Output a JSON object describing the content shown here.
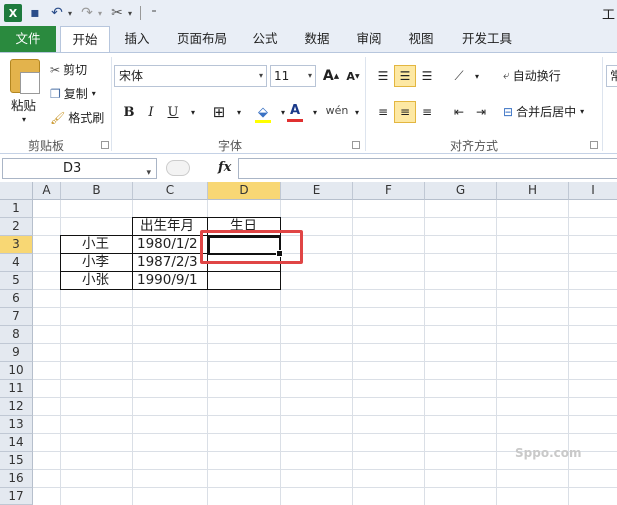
{
  "app": {
    "title_fragment": "工",
    "icons": [
      "excel-icon",
      "save-icon",
      "undo-icon",
      "redo-icon",
      "tools-icon"
    ]
  },
  "tabs": [
    {
      "label": "文件"
    },
    {
      "label": "开始"
    },
    {
      "label": "插入"
    },
    {
      "label": "页面布局"
    },
    {
      "label": "公式"
    },
    {
      "label": "数据"
    },
    {
      "label": "审阅"
    },
    {
      "label": "视图"
    },
    {
      "label": "开发工具"
    }
  ],
  "ribbon": {
    "clipboard": {
      "paste": "粘贴",
      "cut": "剪切",
      "copy": "复制",
      "format_painter": "格式刷",
      "group": "剪贴板"
    },
    "font": {
      "name": "宋体",
      "size": "11",
      "bold": "B",
      "italic": "I",
      "underline": "U",
      "group": "字体"
    },
    "alignment": {
      "wrap": "自动换行",
      "merge": "合并后居中",
      "group": "对齐方式"
    },
    "number": {
      "fragment": "常"
    }
  },
  "formula_bar": {
    "name_box": "D3",
    "fx": "fx",
    "value": ""
  },
  "sheet": {
    "columns": [
      "A",
      "B",
      "C",
      "D",
      "E",
      "F",
      "G",
      "H",
      "I"
    ],
    "rows": [
      "1",
      "2",
      "3",
      "4",
      "5",
      "6",
      "7",
      "8",
      "9",
      "10",
      "11",
      "12",
      "13",
      "14",
      "15",
      "16",
      "17"
    ],
    "selected_column": "D",
    "selected_row": "3",
    "cells": {
      "C2": "出生年月",
      "D2": "生日",
      "B3": "小王",
      "C3": "1980/1/2",
      "B4": "小李",
      "C4": "1987/2/3",
      "B5": "小张",
      "C5": "1990/9/1"
    }
  },
  "watermark": "Sppo.com"
}
